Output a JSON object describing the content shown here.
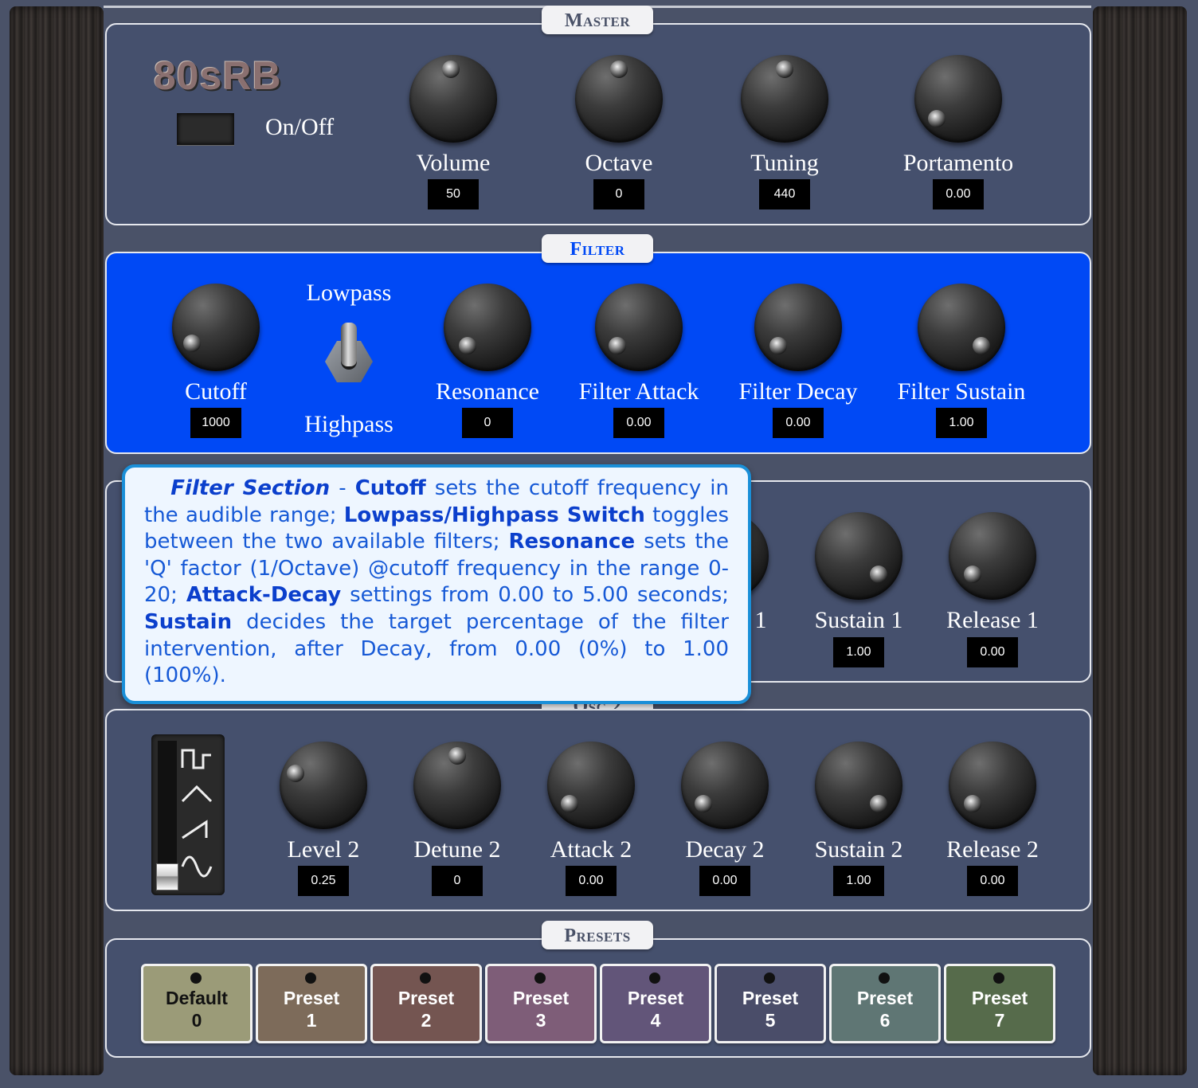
{
  "master": {
    "tab": "Master",
    "logo": "80sRB",
    "power_label": "On/Off",
    "knobs": [
      {
        "label": "Volume",
        "value": "50"
      },
      {
        "label": "Octave",
        "value": "0"
      },
      {
        "label": "Tuning",
        "value": "440"
      },
      {
        "label": "Portamento",
        "value": "0.00"
      }
    ]
  },
  "filter": {
    "tab": "Filter",
    "switch_top": "Lowpass",
    "switch_bottom": "Highpass",
    "knobs": [
      {
        "label": "Cutoff",
        "value": "1000"
      },
      {
        "label": "Resonance",
        "value": "0"
      },
      {
        "label": "Filter Attack",
        "value": "0.00"
      },
      {
        "label": "Filter Decay",
        "value": "0.00"
      },
      {
        "label": "Filter Sustain",
        "value": "1.00"
      }
    ]
  },
  "osc1": {
    "partial_label": "1",
    "knobs": [
      {
        "label": "Sustain 1",
        "value": "1.00"
      },
      {
        "label": "Release 1",
        "value": "0.00"
      }
    ]
  },
  "osc2": {
    "tab": "Osc 2",
    "waveforms": [
      "square",
      "triangle",
      "sawtooth",
      "sine"
    ],
    "waveform_selected": "sine",
    "knobs": [
      {
        "label": "Level 2",
        "value": "0.25"
      },
      {
        "label": "Detune 2",
        "value": "0"
      },
      {
        "label": "Attack 2",
        "value": "0.00"
      },
      {
        "label": "Decay 2",
        "value": "0.00"
      },
      {
        "label": "Sustain 2",
        "value": "1.00"
      },
      {
        "label": "Release 2",
        "value": "0.00"
      }
    ]
  },
  "presets": {
    "tab": "Presets",
    "items": [
      {
        "line1": "Default",
        "line2": "0",
        "color": "#9b9b78"
      },
      {
        "line1": "Preset",
        "line2": "1",
        "color": "#7d6b5a"
      },
      {
        "line1": "Preset",
        "line2": "2",
        "color": "#745551"
      },
      {
        "line1": "Preset",
        "line2": "3",
        "color": "#7e5d78"
      },
      {
        "line1": "Preset",
        "line2": "4",
        "color": "#625579"
      },
      {
        "line1": "Preset",
        "line2": "5",
        "color": "#4a4d69"
      },
      {
        "line1": "Preset",
        "line2": "6",
        "color": "#5f7674"
      },
      {
        "line1": "Preset",
        "line2": "7",
        "color": "#566b4b"
      }
    ]
  },
  "tooltip": {
    "t1": "Filter Section",
    "t2": " - ",
    "t3": "Cutoff",
    "t4": " sets the cutoff frequen­cy in the audible range;  ",
    "t5": "Lowpass/Highpass Switch",
    "t6": " toggles between the two available filters; ",
    "t7": "Resonance",
    "t8": " sets the 'Q' factor (1/Octave) @cutoff frequency in the range 0-20;  ",
    "t9": "Attack-Decay",
    "t10": " settin­gs from 0.00 to 5.00 seconds;  ",
    "t11": "Sustain",
    "t12": " decides the target percentage of the filter intervention, after Decay, from 0.00 (0%) to 1.00 (100%)."
  },
  "colors": {
    "panel": "#45506d",
    "filter_panel": "#0049f5",
    "tooltip_border": "#1a8fd8",
    "tooltip_text": "#1659d6"
  }
}
